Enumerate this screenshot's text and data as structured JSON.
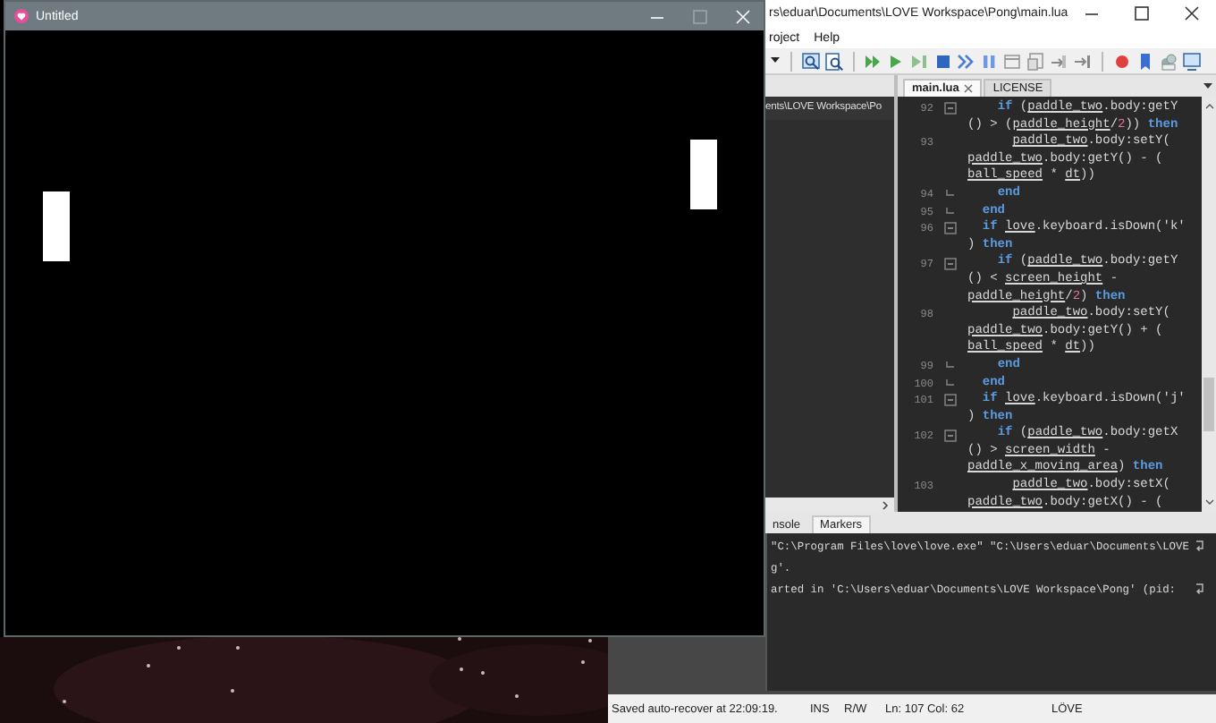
{
  "game_window": {
    "title": "Untitled"
  },
  "editor_window": {
    "title": "rs\\eduar\\Documents\\LOVE Workspace\\Pong\\main.lua",
    "menu": [
      "roject",
      "Help"
    ],
    "project_path": "ents\\LOVE Workspace\\Po",
    "tabs": [
      {
        "label": "main.lua",
        "selected": true,
        "closable": true
      },
      {
        "label": "LICENSE",
        "selected": false,
        "closable": false
      }
    ],
    "code_lines": [
      {
        "number": "92",
        "fold_start": true,
        "fold_end": false,
        "rows": [
          {
            "segments": [
              {
                "kind": "keyword",
                "text": "    if"
              },
              {
                "kind": "text",
                "text": " ("
              },
              {
                "kind": "name",
                "text": "paddle_two"
              },
              {
                "kind": "text",
                "text": ".body:getY"
              }
            ]
          },
          {
            "segments": [
              {
                "kind": "text",
                "text": "() > ("
              },
              {
                "kind": "name",
                "text": "paddle_height"
              },
              {
                "kind": "text",
                "text": "/"
              },
              {
                "kind": "number",
                "text": "2"
              },
              {
                "kind": "text",
                "text": ")) "
              },
              {
                "kind": "keyword",
                "text": "then"
              }
            ]
          }
        ]
      },
      {
        "number": "93",
        "fold_start": false,
        "fold_end": false,
        "rows": [
          {
            "segments": [
              {
                "kind": "name",
                "text": "      paddle_two"
              },
              {
                "kind": "text",
                "text": ".body:setY("
              }
            ]
          },
          {
            "segments": [
              {
                "kind": "name",
                "text": "paddle_two"
              },
              {
                "kind": "text",
                "text": ".body:getY() - ("
              }
            ]
          },
          {
            "segments": [
              {
                "kind": "name",
                "text": "ball_speed"
              },
              {
                "kind": "text",
                "text": " * "
              },
              {
                "kind": "name",
                "text": "dt"
              },
              {
                "kind": "text",
                "text": "))"
              }
            ]
          }
        ]
      },
      {
        "number": "94",
        "fold_start": false,
        "fold_end": true,
        "rows": [
          {
            "segments": [
              {
                "kind": "keyword",
                "text": "    end"
              }
            ]
          }
        ]
      },
      {
        "number": "95",
        "fold_start": false,
        "fold_end": true,
        "rows": [
          {
            "segments": [
              {
                "kind": "keyword",
                "text": "  end"
              }
            ]
          }
        ]
      },
      {
        "number": "96",
        "fold_start": true,
        "fold_end": false,
        "rows": [
          {
            "segments": [
              {
                "kind": "keyword",
                "text": "  if "
              },
              {
                "kind": "name",
                "text": "love"
              },
              {
                "kind": "text",
                "text": ".keyboard.isDown('k'"
              }
            ]
          },
          {
            "segments": [
              {
                "kind": "text",
                "text": ") "
              },
              {
                "kind": "keyword",
                "text": "then"
              }
            ]
          }
        ]
      },
      {
        "number": "97",
        "fold_start": true,
        "fold_end": false,
        "rows": [
          {
            "segments": [
              {
                "kind": "keyword",
                "text": "    if"
              },
              {
                "kind": "text",
                "text": " ("
              },
              {
                "kind": "name",
                "text": "paddle_two"
              },
              {
                "kind": "text",
                "text": ".body:getY"
              }
            ]
          },
          {
            "segments": [
              {
                "kind": "text",
                "text": "() < "
              },
              {
                "kind": "name",
                "text": "screen_height"
              },
              {
                "kind": "text",
                "text": " -"
              }
            ]
          },
          {
            "segments": [
              {
                "kind": "name",
                "text": "paddle_height"
              },
              {
                "kind": "text",
                "text": "/"
              },
              {
                "kind": "number",
                "text": "2"
              },
              {
                "kind": "text",
                "text": ") "
              },
              {
                "kind": "keyword",
                "text": "then"
              }
            ]
          }
        ]
      },
      {
        "number": "98",
        "fold_start": false,
        "fold_end": false,
        "rows": [
          {
            "segments": [
              {
                "kind": "name",
                "text": "      paddle_two"
              },
              {
                "kind": "text",
                "text": ".body:setY("
              }
            ]
          },
          {
            "segments": [
              {
                "kind": "name",
                "text": "paddle_two"
              },
              {
                "kind": "text",
                "text": ".body:getY() + ("
              }
            ]
          },
          {
            "segments": [
              {
                "kind": "name",
                "text": "ball_speed"
              },
              {
                "kind": "text",
                "text": " * "
              },
              {
                "kind": "name",
                "text": "dt"
              },
              {
                "kind": "text",
                "text": "))"
              }
            ]
          }
        ]
      },
      {
        "number": "99",
        "fold_start": false,
        "fold_end": true,
        "rows": [
          {
            "segments": [
              {
                "kind": "keyword",
                "text": "    end"
              }
            ]
          }
        ]
      },
      {
        "number": "100",
        "fold_start": false,
        "fold_end": true,
        "rows": [
          {
            "segments": [
              {
                "kind": "keyword",
                "text": "  end"
              }
            ]
          }
        ]
      },
      {
        "number": "101",
        "fold_start": true,
        "fold_end": false,
        "rows": [
          {
            "segments": [
              {
                "kind": "keyword",
                "text": "  if "
              },
              {
                "kind": "name",
                "text": "love"
              },
              {
                "kind": "text",
                "text": ".keyboard.isDown('j'"
              }
            ]
          },
          {
            "segments": [
              {
                "kind": "text",
                "text": ") "
              },
              {
                "kind": "keyword",
                "text": "then"
              }
            ]
          }
        ]
      },
      {
        "number": "102",
        "fold_start": true,
        "fold_end": false,
        "rows": [
          {
            "segments": [
              {
                "kind": "keyword",
                "text": "    if"
              },
              {
                "kind": "text",
                "text": " ("
              },
              {
                "kind": "name",
                "text": "paddle_two"
              },
              {
                "kind": "text",
                "text": ".body:getX"
              }
            ]
          },
          {
            "segments": [
              {
                "kind": "text",
                "text": "() > "
              },
              {
                "kind": "name",
                "text": "screen_width"
              },
              {
                "kind": "text",
                "text": " -"
              }
            ]
          },
          {
            "segments": [
              {
                "kind": "name",
                "text": "paddle_x_moving_area"
              },
              {
                "kind": "text",
                "text": ") "
              },
              {
                "kind": "keyword",
                "text": "then"
              }
            ]
          }
        ]
      },
      {
        "number": "103",
        "fold_start": false,
        "fold_end": false,
        "rows": [
          {
            "segments": [
              {
                "kind": "name",
                "text": "      paddle_two"
              },
              {
                "kind": "text",
                "text": ".body:setX("
              }
            ]
          },
          {
            "segments": [
              {
                "kind": "name",
                "text": "paddle_two"
              },
              {
                "kind": "text",
                "text": ".body:getX() - ("
              }
            ]
          }
        ]
      }
    ],
    "output_tabs": [
      {
        "label": "nsole",
        "selected": false
      },
      {
        "label": "Markers",
        "selected": false
      }
    ],
    "console_lines": [
      {
        "text": "\"C:\\Program Files\\love\\love.exe\" \"C:\\Users\\eduar\\Documents\\LOVE",
        "wrapped": true
      },
      {
        "text": "g'.",
        "wrapped": false
      },
      {
        "text": "arted in 'C:\\Users\\eduar\\Documents\\LOVE Workspace\\Pong' (pid:",
        "wrapped": true
      }
    ],
    "status_bar": {
      "message": "Saved auto-recover at 22:09:19.",
      "mode": "INS",
      "access": "R/W",
      "position": "Ln: 107 Col: 62",
      "interpreter": "LÖVE"
    }
  }
}
